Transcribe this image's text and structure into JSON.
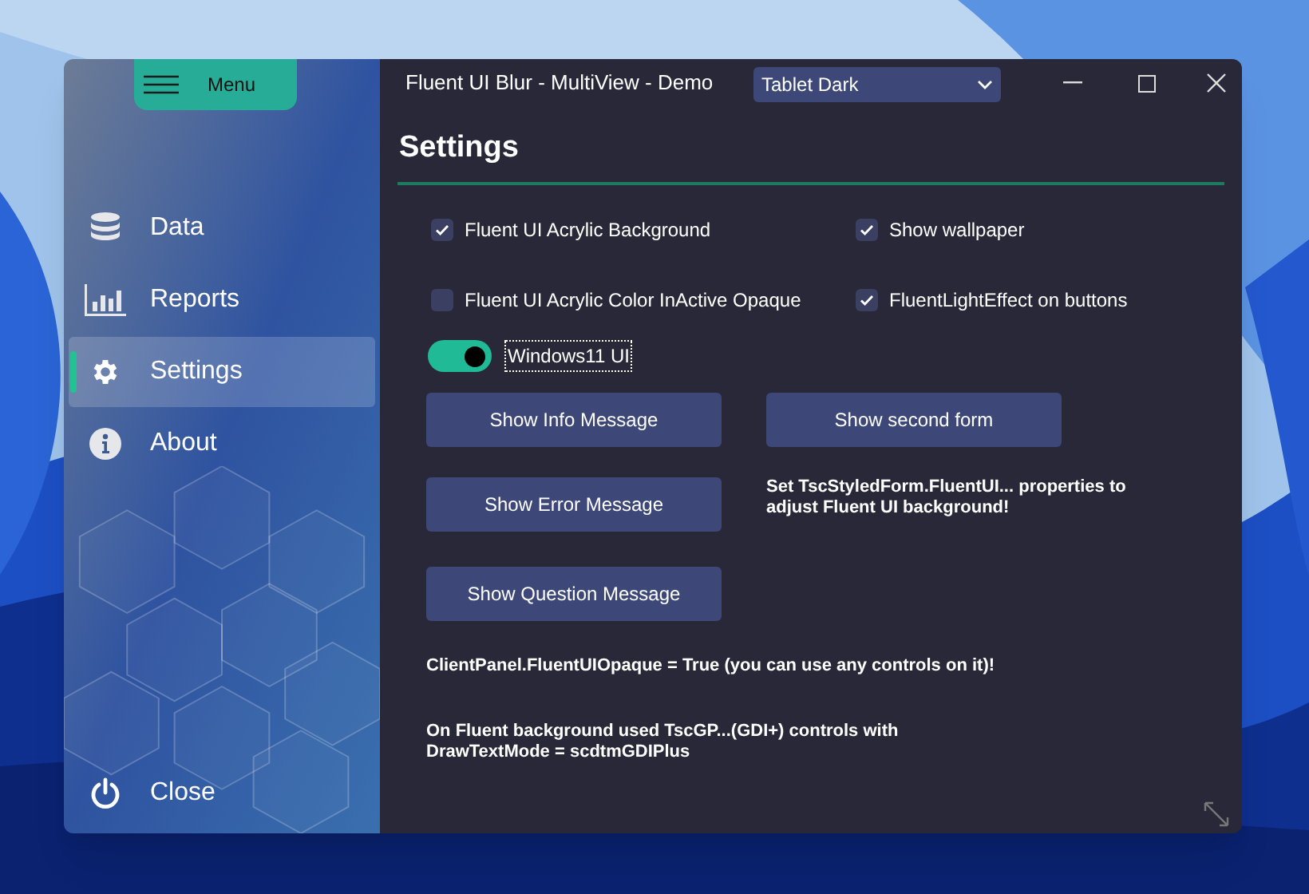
{
  "window": {
    "title": "Fluent UI Blur - MultiView - Demo"
  },
  "menu_button": {
    "label": "Menu"
  },
  "sidebar": {
    "items": [
      {
        "label": "Data",
        "selected": false
      },
      {
        "label": "Reports",
        "selected": false
      },
      {
        "label": "Settings",
        "selected": true
      },
      {
        "label": "About",
        "selected": false
      }
    ],
    "close": {
      "label": "Close"
    }
  },
  "theme_select": {
    "value": "Tablet Dark"
  },
  "heading": "Settings",
  "checkboxes": [
    {
      "label": "Fluent UI Acrylic Background",
      "checked": true
    },
    {
      "label": "Show wallpaper",
      "checked": true
    },
    {
      "label": "Fluent UI Acrylic Color InActive Opaque",
      "checked": false
    },
    {
      "label": "FluentLightEffect on buttons",
      "checked": true
    }
  ],
  "toggle": {
    "label": "Windows11 UI",
    "on": true
  },
  "buttons": [
    "Show Info Message",
    "Show second form",
    "Show Error Message",
    "Show Question Message"
  ],
  "notes": [
    "Set TscStyledForm.FluentUI... properties to adjust Fluent UI background!",
    "ClientPanel.FluentUIOpaque = True (you can use any controls on it)!",
    "On Fluent background used TscGP...(GDI+) controls with DrawTextMode = scdtmGDIPlus"
  ]
}
